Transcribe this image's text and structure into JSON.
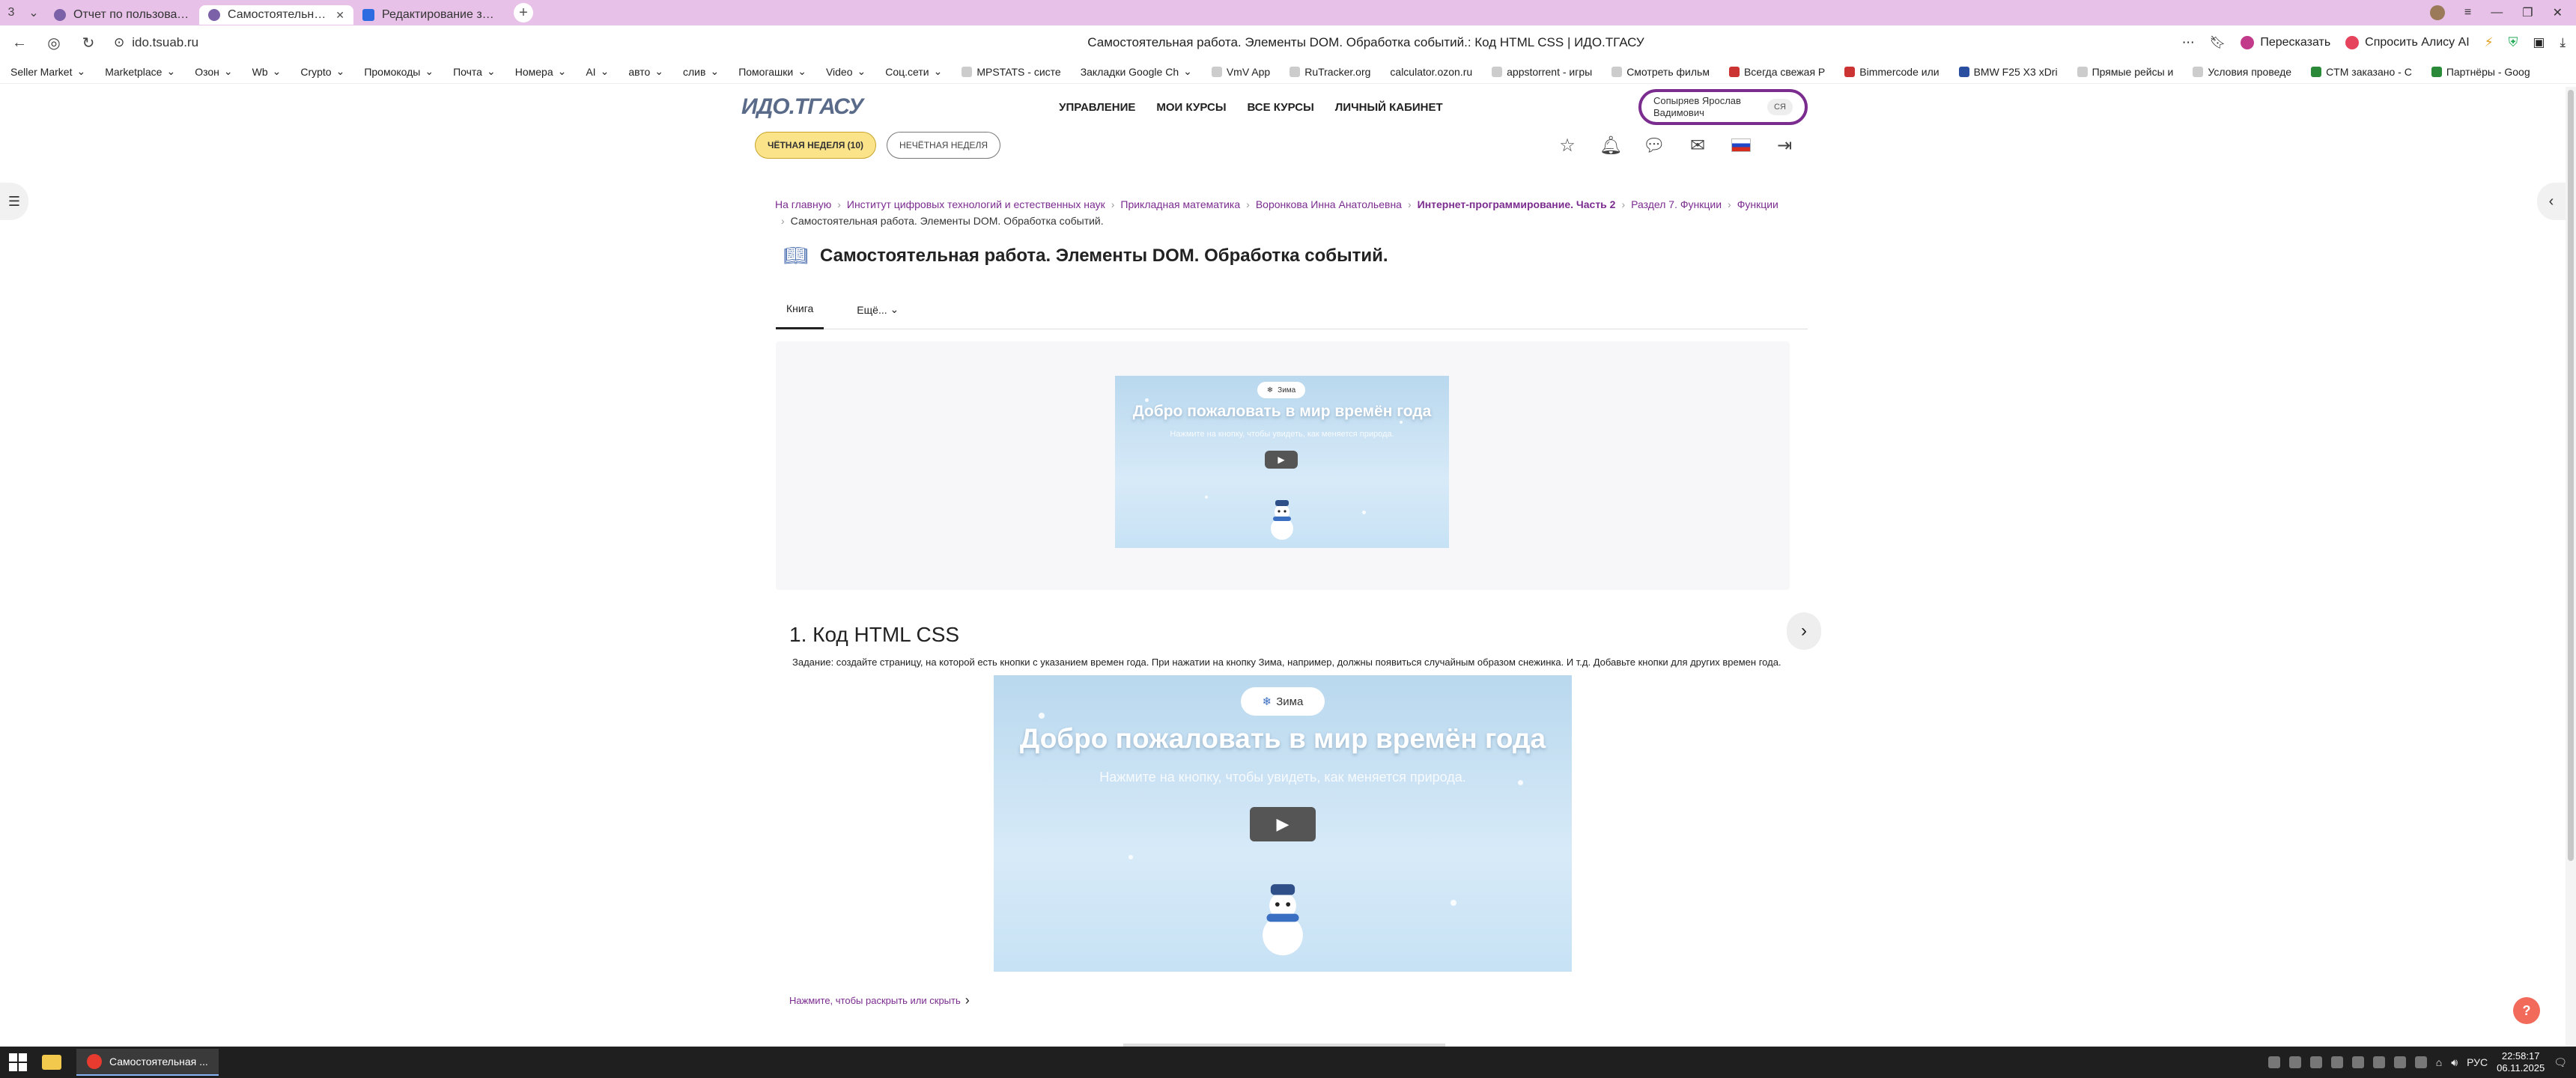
{
  "browser": {
    "tab_count": "3",
    "tabs": [
      {
        "label": "Отчет по пользователю |"
      },
      {
        "label": "Самостоятельная раб"
      },
      {
        "label": "Редактирование заказа ."
      }
    ],
    "url": "ido.tsuab.ru",
    "page_title": "Самостоятельная работа. Элементы DOM. Обработка событий.: Код HTML CSS | ИДО.ТГАСУ",
    "retell": "Пересказать",
    "alice": "Спросить Алису AI"
  },
  "bookmarks": [
    "Seller Market",
    "Marketplace",
    "Озон",
    "Wb",
    "Crypto",
    "Промокоды",
    "Почта",
    "Номера",
    "AI",
    "авто",
    "слив",
    "Помогашки",
    "Video",
    "Соц.сети",
    "MPSTATS - систе",
    "Закладки Google Ch",
    "VmV App",
    "RuTracker.org",
    "calculator.ozon.ru",
    "appstorrent - игры",
    "Смотреть фильм",
    "Всегда свежая Р",
    "Bimmercode или",
    "BMW F25 X3 xDri",
    "Прямые рейсы и",
    "Условия проведе",
    "CTM заказано - C",
    "Партнёры - Goog"
  ],
  "site": {
    "logo": "ИДО.ТГАСУ",
    "nav": [
      "УПРАВЛЕНИЕ",
      "МОИ КУРСЫ",
      "ВСЕ КУРСЫ",
      "ЛИЧНЫЙ КАБИНЕТ"
    ],
    "user_name_line1": "Сопыряев Ярослав",
    "user_name_line2": "Вадимович",
    "user_initials": "СЯ",
    "even_week": "ЧЁТНАЯ НЕДЕЛЯ (10)",
    "odd_week": "НЕЧЁТНАЯ НЕДЕЛЯ"
  },
  "breadcrumb": {
    "items": [
      "На главную",
      "Институт цифровых технологий и естественных наук",
      "Прикладная математика",
      "Воронкова Инна Анатольевна",
      "Интернет-программирование. Часть 2",
      "Раздел 7. Функции",
      "Функции"
    ],
    "current": "Самостоятельная работа. Элементы DOM. Обработка событий."
  },
  "page": {
    "heading": "Самостоятельная работа. Элементы DOM. Обработка событий.",
    "tab_book": "Книга",
    "tab_more": "Ещё...",
    "section_title": "1. Код HTML CSS",
    "task": "Задание: создайте страницу, на которой есть кнопки с указанием времен года. При нажатии на кнопку Зима, например, должны появиться случайным образом снежинка. И т.д. Добавьте кнопки для других времен года.",
    "expand": "Нажмите, чтобы раскрыть или скрыть"
  },
  "scene": {
    "chip": "Зима",
    "title": "Добро пожаловать в мир времён года",
    "subtitle": "Нажмите на кнопку, чтобы увидеть, как меняется природа."
  },
  "taskbar": {
    "app_label": "Самостоятельная ...",
    "lang": "РУС",
    "time": "22:58:17",
    "date": "06.11.2025"
  },
  "colors": {
    "accent": "#7b2c8f",
    "tabbar": "#e7c1e7",
    "even_week": "#fbe38a"
  }
}
